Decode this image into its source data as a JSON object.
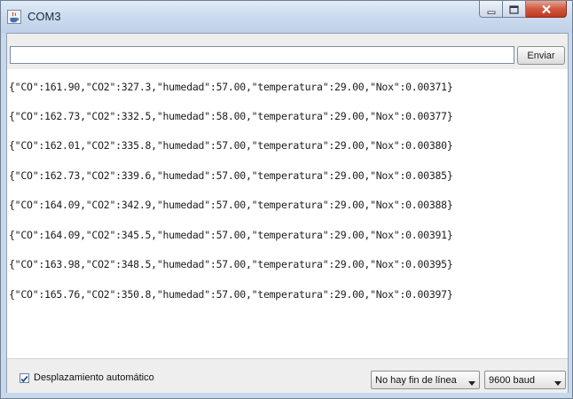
{
  "window": {
    "title": "COM3"
  },
  "input": {
    "value": "",
    "send_label": "Enviar"
  },
  "console": {
    "lines": [
      "{\"CO\":161.90,\"CO2\":327.3,\"humedad\":57.00,\"temperatura\":29.00,\"Nox\":0.00371}",
      "{\"CO\":162.73,\"CO2\":332.5,\"humedad\":58.00,\"temperatura\":29.00,\"Nox\":0.00377}",
      "{\"CO\":162.01,\"CO2\":335.8,\"humedad\":57.00,\"temperatura\":29.00,\"Nox\":0.00380}",
      "{\"CO\":162.73,\"CO2\":339.6,\"humedad\":57.00,\"temperatura\":29.00,\"Nox\":0.00385}",
      "{\"CO\":164.09,\"CO2\":342.9,\"humedad\":57.00,\"temperatura\":29.00,\"Nox\":0.00388}",
      "{\"CO\":164.09,\"CO2\":345.5,\"humedad\":57.00,\"temperatura\":29.00,\"Nox\":0.00391}",
      "{\"CO\":163.98,\"CO2\":348.5,\"humedad\":57.00,\"temperatura\":29.00,\"Nox\":0.00395}",
      "{\"CO\":165.76,\"CO2\":350.8,\"humedad\":57.00,\"temperatura\":29.00,\"Nox\":0.00397}"
    ]
  },
  "status": {
    "autoscroll_label": "Desplazamiento automático",
    "autoscroll_checked": true,
    "line_ending": "No hay fin de línea",
    "baud": "9600 baud"
  },
  "colors": {
    "titlebar": "#cddcef",
    "close_button": "#c7432a",
    "console_text": "#1c1c1c"
  }
}
